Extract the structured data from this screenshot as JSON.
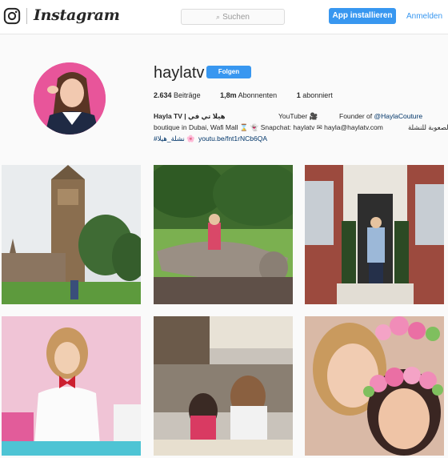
{
  "topbar": {
    "brand": "Instagram",
    "search_placeholder": "Suchen",
    "install_button": "App installieren",
    "login_link": "Anmelden"
  },
  "profile": {
    "username": "haylatv",
    "follow_button": "Folgen",
    "stats": [
      {
        "value": "2.634",
        "label": "Beiträge"
      },
      {
        "value": "1,8m",
        "label": "Abonnenten"
      },
      {
        "value": "1",
        "label": "abonniert"
      }
    ],
    "bio": {
      "name": "Hayla TV | هيلا تي في",
      "youtuber": "YouTuber 🎥",
      "founder_prefix": "Founder of ",
      "founder_link": "@HaylaCouture",
      "line2_left": "boutique in Dubai, Wafi Mall ⌛ 👻 Snapchat: haylatv ✉ hayla@haylatv.com",
      "line2_right": "الصعوبة للنشلة",
      "line3_tag": "#نشلة_هيلا 🌸",
      "line3_link": "youtu.be/fnt1rNCb6QA"
    }
  },
  "colors": {
    "accent": "#3897f0",
    "link": "#003569",
    "avatar_bg": "#e8559a"
  },
  "posts": [
    {
      "subject": "Big Ben tower in London"
    },
    {
      "subject": "Girl sitting on a fallen log in a park"
    },
    {
      "subject": "Girl posing at a brick townhouse door"
    },
    {
      "subject": "Girl in white top with red bow"
    },
    {
      "subject": "Two girls at a cafe table"
    },
    {
      "subject": "Selfie with flower crown filter"
    }
  ]
}
